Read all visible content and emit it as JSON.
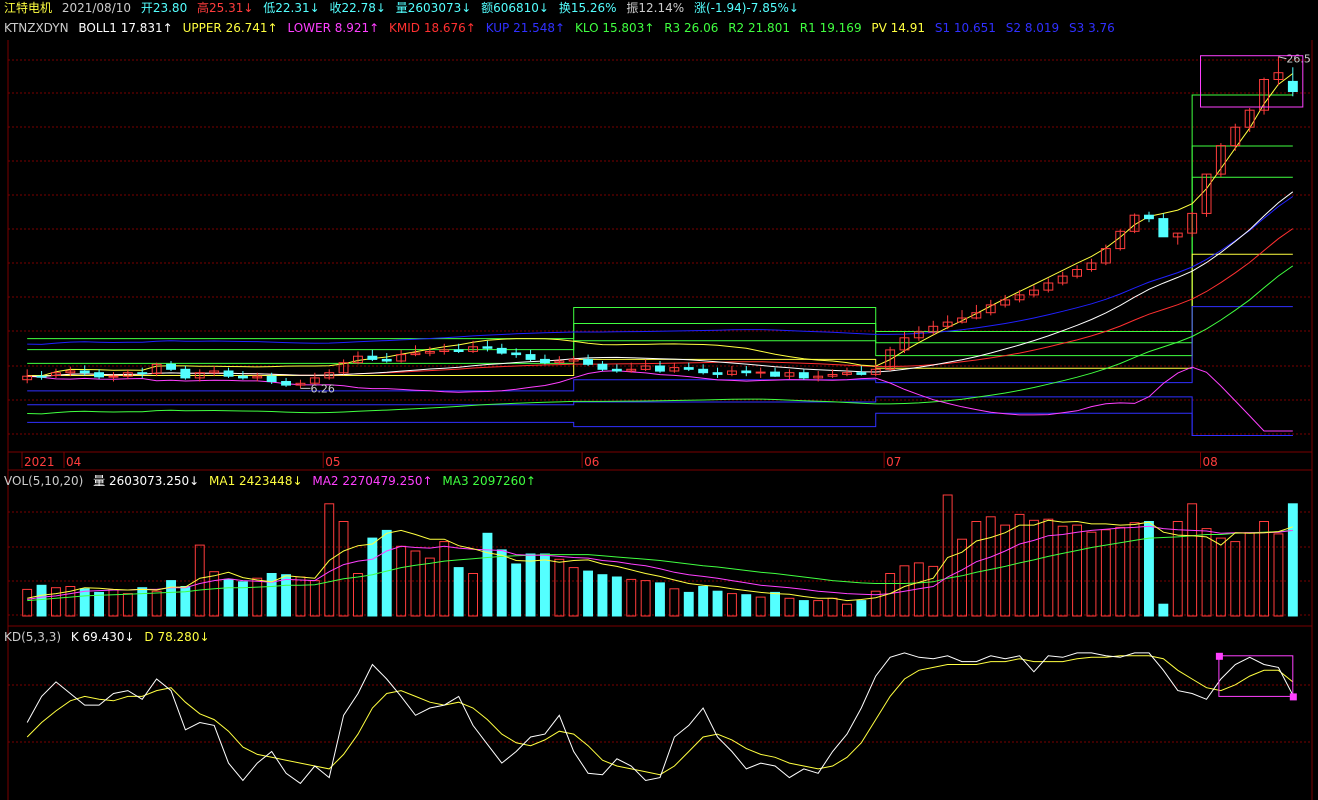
{
  "header": {
    "stock_name": "江特电机",
    "date": "2021/08/10",
    "open": "开23.80",
    "high": "高25.31↓",
    "low": "低22.31↓",
    "close": "收22.78↓",
    "volume": "量2603073↓",
    "amount": "额606810↓",
    "turnover": "换15.26%",
    "amplitude": "振12.14%",
    "change": "涨(-1.94)-7.85%↓"
  },
  "indicator_line": {
    "name": "KTNZXDYN",
    "boll1": "BOLL1 17.831↑",
    "upper": "UPPER 26.741↑",
    "lower": "LOWER 8.921↑",
    "kmid": "KMID 18.676↑",
    "kup": "KUP 21.548↑",
    "klo": "KLO 15.803↑",
    "r3": "R3 26.06",
    "r2": "R2 21.801",
    "r1": "R1 19.169",
    "pv": "PV 14.91",
    "s1": "S1 10.651",
    "s2": "S2 8.019",
    "s3": "S3 3.76"
  },
  "volume_line": {
    "name": "VOL(5,10,20)",
    "vol": "量 2603073.250↓",
    "ma1": "MA1 2423448↓",
    "ma2": "MA2 2270479.250↑",
    "ma3": "MA3 2097260↑"
  },
  "kd_line": {
    "name": "KD(5,3,3)",
    "k": "K 69.430↓",
    "d": "D 78.280↓"
  },
  "price_annotations": {
    "max_label": "26.5",
    "min_label": "6.26"
  },
  "colors": {
    "up": "#ff3c3c",
    "down": "#54ffff",
    "grid": "#7a0000",
    "boll": "#ffffff",
    "upper": "#ffff40",
    "lower": "#ff40ff",
    "kmid": "#ff3030",
    "kup": "#2020ff",
    "klo": "#40ff40",
    "k": "#ffffff",
    "d": "#ffff40"
  },
  "chart_data": [
    {
      "type": "candlestick",
      "x": [
        "2021-04-01",
        "2021-04-02",
        "2021-04-06",
        "2021-04-07",
        "2021-04-08",
        "2021-04-09",
        "2021-04-12",
        "2021-04-13",
        "2021-04-14",
        "2021-04-15",
        "2021-04-16",
        "2021-04-19",
        "2021-04-20",
        "2021-04-21",
        "2021-04-22",
        "2021-04-23",
        "2021-04-26",
        "2021-04-27",
        "2021-04-28",
        "2021-04-29",
        "2021-04-30",
        "2021-05-06",
        "2021-05-07",
        "2021-05-10",
        "2021-05-11",
        "2021-05-12",
        "2021-05-13",
        "2021-05-14",
        "2021-05-17",
        "2021-05-18",
        "2021-05-19",
        "2021-05-20",
        "2021-05-21",
        "2021-05-24",
        "2021-05-25",
        "2021-05-26",
        "2021-05-27",
        "2021-05-28",
        "2021-05-31",
        "2021-06-01",
        "2021-06-02",
        "2021-06-03",
        "2021-06-04",
        "2021-06-07",
        "2021-06-08",
        "2021-06-09",
        "2021-06-10",
        "2021-06-11",
        "2021-06-15",
        "2021-06-16",
        "2021-06-17",
        "2021-06-18",
        "2021-06-21",
        "2021-06-22",
        "2021-06-23",
        "2021-06-24",
        "2021-06-25",
        "2021-06-28",
        "2021-06-29",
        "2021-06-30",
        "2021-07-01",
        "2021-07-02",
        "2021-07-05",
        "2021-07-06",
        "2021-07-07",
        "2021-07-08",
        "2021-07-09",
        "2021-07-12",
        "2021-07-13",
        "2021-07-14",
        "2021-07-15",
        "2021-07-16",
        "2021-07-19",
        "2021-07-20",
        "2021-07-21",
        "2021-07-22",
        "2021-07-23",
        "2021-07-26",
        "2021-07-27",
        "2021-07-28",
        "2021-07-29",
        "2021-07-30",
        "2021-08-02",
        "2021-08-03",
        "2021-08-04",
        "2021-08-05",
        "2021-08-06",
        "2021-08-09",
        "2021-08-10"
      ],
      "open": [
        6.5,
        6.6,
        6.62,
        6.7,
        6.75,
        6.7,
        6.58,
        6.6,
        6.7,
        6.68,
        6.95,
        6.8,
        6.55,
        6.7,
        6.75,
        6.6,
        6.55,
        6.6,
        6.45,
        6.35,
        6.4,
        6.55,
        6.7,
        7.0,
        7.2,
        7.1,
        7.05,
        7.25,
        7.3,
        7.35,
        7.4,
        7.35,
        7.5,
        7.45,
        7.3,
        7.25,
        7.1,
        7.0,
        7.05,
        7.1,
        6.95,
        6.8,
        6.75,
        6.8,
        6.9,
        6.75,
        6.85,
        6.8,
        6.7,
        6.65,
        6.75,
        6.7,
        6.72,
        6.6,
        6.7,
        6.55,
        6.6,
        6.65,
        6.7,
        6.65,
        6.8,
        7.4,
        7.8,
        8.0,
        8.2,
        8.35,
        8.5,
        8.7,
        9.0,
        9.2,
        9.4,
        9.6,
        9.9,
        10.2,
        10.5,
        10.8,
        11.5,
        12.4,
        13.3,
        13.1,
        12.1,
        12.3,
        13.4,
        15.9,
        18.0,
        19.5,
        21.0,
        24.0,
        23.8
      ],
      "high": [
        6.8,
        6.75,
        6.82,
        6.88,
        6.92,
        6.8,
        6.72,
        6.8,
        6.85,
        7.0,
        7.05,
        6.9,
        6.8,
        6.9,
        6.85,
        6.75,
        6.7,
        6.7,
        6.55,
        6.5,
        6.7,
        6.8,
        7.1,
        7.35,
        7.4,
        7.3,
        7.4,
        7.55,
        7.5,
        7.6,
        7.6,
        7.7,
        7.7,
        7.6,
        7.45,
        7.4,
        7.25,
        7.2,
        7.2,
        7.25,
        7.05,
        6.95,
        7.0,
        7.1,
        7.05,
        7.0,
        7.0,
        6.95,
        6.85,
        6.9,
        6.9,
        6.85,
        6.85,
        6.8,
        6.8,
        6.75,
        6.8,
        6.85,
        6.9,
        6.95,
        7.5,
        8.0,
        8.2,
        8.4,
        8.6,
        8.8,
        9.0,
        9.2,
        9.4,
        9.6,
        9.8,
        10.1,
        10.4,
        10.7,
        11.0,
        11.7,
        12.5,
        13.4,
        13.5,
        13.4,
        12.3,
        13.5,
        15.9,
        18.2,
        19.8,
        21.2,
        24.2,
        26.5,
        25.31
      ],
      "low": [
        6.4,
        6.5,
        6.55,
        6.6,
        6.62,
        6.52,
        6.45,
        6.52,
        6.55,
        6.6,
        6.75,
        6.5,
        6.45,
        6.6,
        6.55,
        6.5,
        6.45,
        6.38,
        6.3,
        6.26,
        6.35,
        6.5,
        6.65,
        6.95,
        7.05,
        7.0,
        7.0,
        7.2,
        7.2,
        7.25,
        7.3,
        7.3,
        7.35,
        7.25,
        7.15,
        7.05,
        6.95,
        6.95,
        7.0,
        6.9,
        6.75,
        6.7,
        6.7,
        6.75,
        6.7,
        6.7,
        6.75,
        6.65,
        6.55,
        6.6,
        6.6,
        6.55,
        6.58,
        6.52,
        6.5,
        6.45,
        6.55,
        6.6,
        6.62,
        6.6,
        6.75,
        7.3,
        7.7,
        7.9,
        8.1,
        8.3,
        8.45,
        8.6,
        8.9,
        9.1,
        9.3,
        9.5,
        9.8,
        10.1,
        10.4,
        10.7,
        11.4,
        12.3,
        12.9,
        12.1,
        11.7,
        12.1,
        13.2,
        15.7,
        17.6,
        19.1,
        20.6,
        23.4,
        22.31
      ],
      "close": [
        6.6,
        6.58,
        6.7,
        6.75,
        6.7,
        6.58,
        6.6,
        6.7,
        6.68,
        6.95,
        6.8,
        6.55,
        6.7,
        6.75,
        6.6,
        6.55,
        6.6,
        6.45,
        6.35,
        6.4,
        6.55,
        6.7,
        7.0,
        7.2,
        7.1,
        7.05,
        7.25,
        7.3,
        7.35,
        7.4,
        7.35,
        7.5,
        7.45,
        7.3,
        7.25,
        7.1,
        7.0,
        7.05,
        7.1,
        6.95,
        6.8,
        6.75,
        6.8,
        6.9,
        6.75,
        6.85,
        6.8,
        6.7,
        6.65,
        6.75,
        6.7,
        6.72,
        6.6,
        6.7,
        6.55,
        6.6,
        6.65,
        6.7,
        6.65,
        6.8,
        7.4,
        7.8,
        8.0,
        8.2,
        8.35,
        8.5,
        8.7,
        9.0,
        9.2,
        9.4,
        9.6,
        9.9,
        10.2,
        10.5,
        10.8,
        11.5,
        12.4,
        13.3,
        13.1,
        12.1,
        12.3,
        13.4,
        15.9,
        18.0,
        19.5,
        21.0,
        24.0,
        24.72,
        22.78
      ],
      "volume": [
        45,
        52,
        48,
        50,
        46,
        40,
        44,
        38,
        48,
        42,
        60,
        50,
        120,
        75,
        62,
        58,
        64,
        72,
        70,
        66,
        60,
        190,
        160,
        72,
        132,
        145,
        118,
        110,
        98,
        126,
        82,
        72,
        140,
        112,
        88,
        105,
        105,
        96,
        82,
        76,
        70,
        66,
        62,
        60,
        56,
        46,
        40,
        50,
        42,
        38,
        36,
        32,
        40,
        30,
        26,
        26,
        30,
        20,
        26,
        42,
        72,
        85,
        90,
        84,
        205,
        130,
        160,
        168,
        154,
        172,
        162,
        164,
        152,
        154,
        142,
        146,
        150,
        158,
        160,
        20,
        160,
        190,
        148,
        132,
        126,
        141,
        160,
        139,
        190
      ],
      "ma1": [
        30,
        35,
        38,
        42,
        48,
        47,
        45,
        44,
        45,
        44,
        49,
        49,
        64,
        68,
        74,
        65,
        61,
        58,
        68,
        66,
        64,
        94,
        110,
        119,
        122,
        140,
        145,
        138,
        130,
        130,
        119,
        114,
        107,
        103,
        94,
        93,
        95,
        91,
        94,
        95,
        88,
        84,
        78,
        72,
        67,
        61,
        55,
        52,
        50,
        46,
        43,
        40,
        38,
        37,
        33,
        30,
        30,
        26,
        28,
        31,
        38,
        50,
        57,
        64,
        99,
        108,
        127,
        133,
        141,
        154,
        154,
        162,
        159,
        160,
        156,
        156,
        154,
        155,
        159,
        142,
        137,
        136,
        134,
        120,
        141,
        140,
        141,
        143,
        151
      ],
      "ma2": [
        28,
        32,
        34,
        38,
        42,
        43,
        44,
        44,
        45,
        45,
        48,
        48,
        55,
        60,
        63,
        60,
        59,
        57,
        62,
        61,
        60,
        75,
        87,
        93,
        96,
        110,
        118,
        116,
        115,
        118,
        115,
        113,
        112,
        111,
        104,
        103,
        103,
        101,
        99,
        98,
        94,
        92,
        88,
        85,
        80,
        74,
        70,
        67,
        64,
        60,
        56,
        52,
        50,
        48,
        45,
        42,
        40,
        38,
        37,
        36,
        38,
        42,
        46,
        50,
        66,
        78,
        92,
        100,
        110,
        122,
        128,
        136,
        138,
        142,
        145,
        147,
        149,
        150,
        152,
        148,
        146,
        145,
        144,
        140,
        141,
        141,
        141,
        142,
        145
      ],
      "ma3": [
        26,
        28,
        30,
        32,
        34,
        35,
        36,
        37,
        38,
        39,
        40,
        41,
        44,
        46,
        48,
        48,
        49,
        50,
        52,
        52,
        53,
        58,
        63,
        66,
        70,
        76,
        82,
        86,
        89,
        93,
        95,
        97,
        99,
        101,
        102,
        103,
        104,
        104,
        104,
        104,
        102,
        100,
        98,
        96,
        94,
        91,
        88,
        85,
        83,
        80,
        77,
        74,
        72,
        69,
        66,
        63,
        60,
        58,
        56,
        55,
        55,
        55,
        56,
        58,
        64,
        68,
        74,
        79,
        84,
        90,
        95,
        101,
        106,
        111,
        116,
        120,
        124,
        128,
        132,
        133,
        134,
        136,
        138,
        138,
        140,
        141,
        142,
        143,
        145
      ],
      "k": [
        50,
        68,
        78,
        70,
        62,
        62,
        70,
        72,
        66,
        80,
        72,
        45,
        50,
        48,
        22,
        10,
        22,
        30,
        15,
        8,
        20,
        12,
        55,
        70,
        90,
        80,
        68,
        55,
        60,
        62,
        68,
        48,
        35,
        22,
        30,
        40,
        42,
        55,
        30,
        15,
        14,
        25,
        20,
        10,
        12,
        40,
        48,
        60,
        40,
        30,
        18,
        22,
        20,
        12,
        18,
        15,
        30,
        42,
        60,
        82,
        95,
        98,
        95,
        94,
        96,
        92,
        92,
        96,
        94,
        96,
        85,
        96,
        95,
        98,
        98,
        96,
        95,
        98,
        98,
        86,
        72,
        70,
        66,
        80,
        90,
        95,
        90,
        88,
        69
      ],
      "d": [
        40,
        50,
        58,
        65,
        68,
        66,
        65,
        68,
        68,
        72,
        74,
        64,
        56,
        52,
        44,
        33,
        28,
        26,
        24,
        22,
        20,
        18,
        28,
        42,
        60,
        70,
        72,
        68,
        64,
        62,
        64,
        60,
        52,
        42,
        36,
        34,
        38,
        44,
        42,
        34,
        24,
        20,
        18,
        16,
        14,
        20,
        30,
        40,
        42,
        38,
        32,
        28,
        26,
        22,
        20,
        18,
        20,
        26,
        36,
        52,
        68,
        80,
        86,
        88,
        90,
        90,
        90,
        92,
        92,
        94,
        92,
        92,
        92,
        94,
        95,
        95,
        96,
        96,
        96,
        94,
        86,
        80,
        74,
        72,
        76,
        82,
        86,
        86,
        78
      ]
    }
  ]
}
